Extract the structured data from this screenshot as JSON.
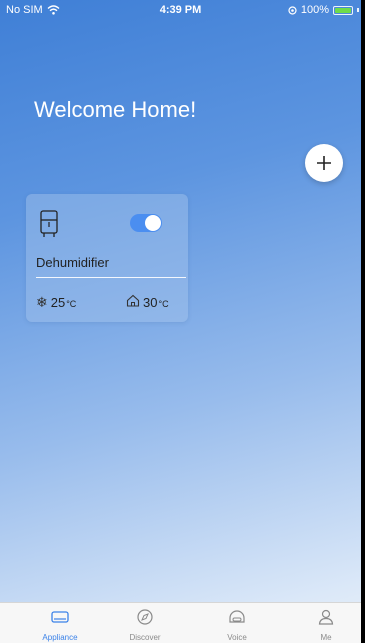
{
  "status_bar": {
    "carrier": "No SIM",
    "time": "4:39 PM",
    "battery": "100%",
    "battery_level": 1.0
  },
  "header": {
    "title": "Welcome Home!",
    "add_icon": "plus-icon"
  },
  "appliance_card": {
    "name": "Dehumidifier",
    "icon": "dehumidifier-icon",
    "power_on": true,
    "set_temp": {
      "value": "25",
      "unit": "°C",
      "icon": "snowflake-icon"
    },
    "room_temp": {
      "value": "30",
      "unit": "°C",
      "icon": "home-icon"
    }
  },
  "tabs": [
    {
      "label": "Appliance",
      "icon": "appliance-icon",
      "active": true
    },
    {
      "label": "Discover",
      "icon": "compass-icon",
      "active": false
    },
    {
      "label": "Voice",
      "icon": "voice-icon",
      "active": false
    },
    {
      "label": "Me",
      "icon": "user-icon",
      "active": false
    }
  ],
  "colors": {
    "accent": "#3b82e8",
    "toggle_on": "#4b8ef0",
    "battery_fill": "#6fdc4a"
  }
}
